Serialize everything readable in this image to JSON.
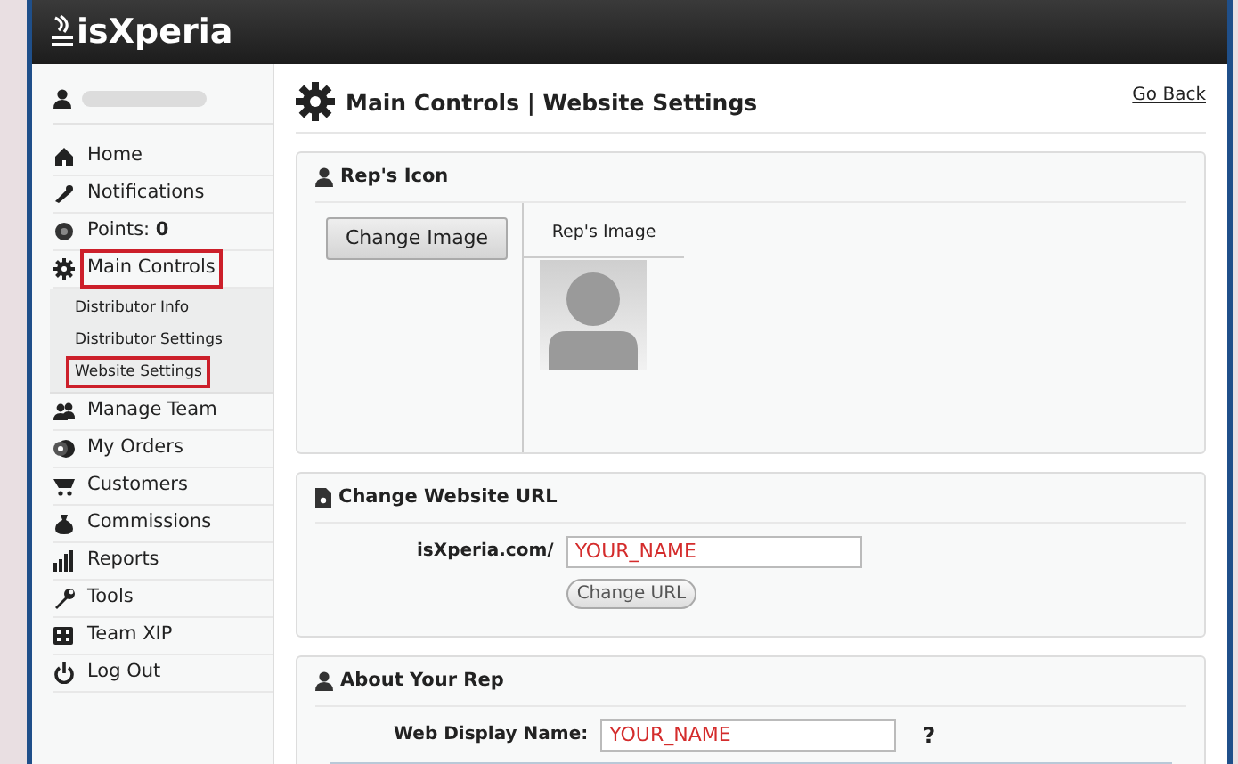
{
  "header": {
    "logo": "isXperia"
  },
  "sidebar": {
    "items": [
      {
        "label": "Home",
        "highlighted": false
      },
      {
        "label": "Notifications",
        "highlighted": false
      },
      {
        "label": "Points: **0**",
        "highlighted": false
      },
      {
        "label": "Main Controls",
        "highlighted": true,
        "children": [
          {
            "label": "Distributor Info",
            "highlighted": false
          },
          {
            "label": "Distributor Settings",
            "highlighted": false
          },
          {
            "label": "Website Settings",
            "highlighted": true
          }
        ]
      },
      {
        "label": "Manage Team",
        "highlighted": false
      },
      {
        "label": "My Orders",
        "highlighted": false
      },
      {
        "label": "Customers",
        "highlighted": false
      },
      {
        "label": "Commissions",
        "highlighted": false
      },
      {
        "label": "Reports",
        "highlighted": false
      },
      {
        "label": "Tools",
        "highlighted": false
      },
      {
        "label": "Team XIP",
        "highlighted": false
      },
      {
        "label": "Log Out",
        "highlighted": false
      }
    ]
  },
  "main": {
    "title": "Main Controls | Website Settings",
    "go_back": "Go Back",
    "rep_icon": {
      "title": "Rep's Icon",
      "button": "Change Image",
      "image_header": "Rep's Image"
    },
    "website_url": {
      "title": "Change Website URL",
      "prefix": "isXperia.com/",
      "value": "YOUR_NAME",
      "button": "Change URL"
    },
    "about_rep": {
      "title": "About Your Rep",
      "label": "Web Display Name:",
      "value": "YOUR_NAME",
      "help": "?"
    }
  }
}
